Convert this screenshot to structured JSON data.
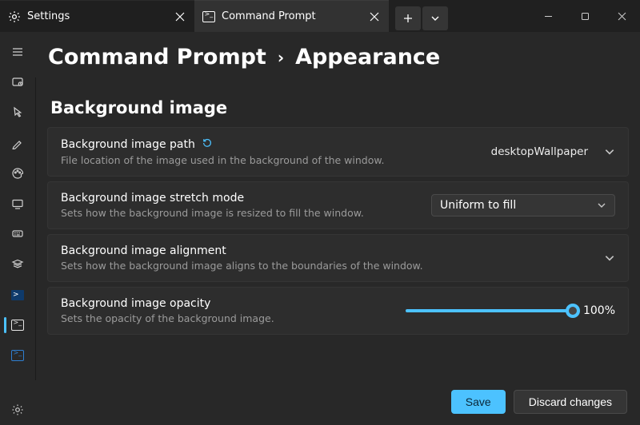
{
  "titlebar": {
    "tabs": [
      {
        "label": "Settings"
      },
      {
        "label": "Command Prompt"
      }
    ]
  },
  "breadcrumb": {
    "parent": "Command Prompt",
    "current": "Appearance"
  },
  "section": {
    "title": "Background image"
  },
  "settings": {
    "path": {
      "title": "Background image path",
      "desc": "File location of the image used in the background of the window.",
      "value": "desktopWallpaper"
    },
    "stretch": {
      "title": "Background image stretch mode",
      "desc": "Sets how the background image is resized to fill the window.",
      "value": "Uniform to fill"
    },
    "alignment": {
      "title": "Background image alignment",
      "desc": "Sets how the background image aligns to the boundaries of the window."
    },
    "opacity": {
      "title": "Background image opacity",
      "desc": "Sets the opacity of the background image.",
      "value": "100%"
    }
  },
  "footer": {
    "save": "Save",
    "discard": "Discard changes"
  }
}
